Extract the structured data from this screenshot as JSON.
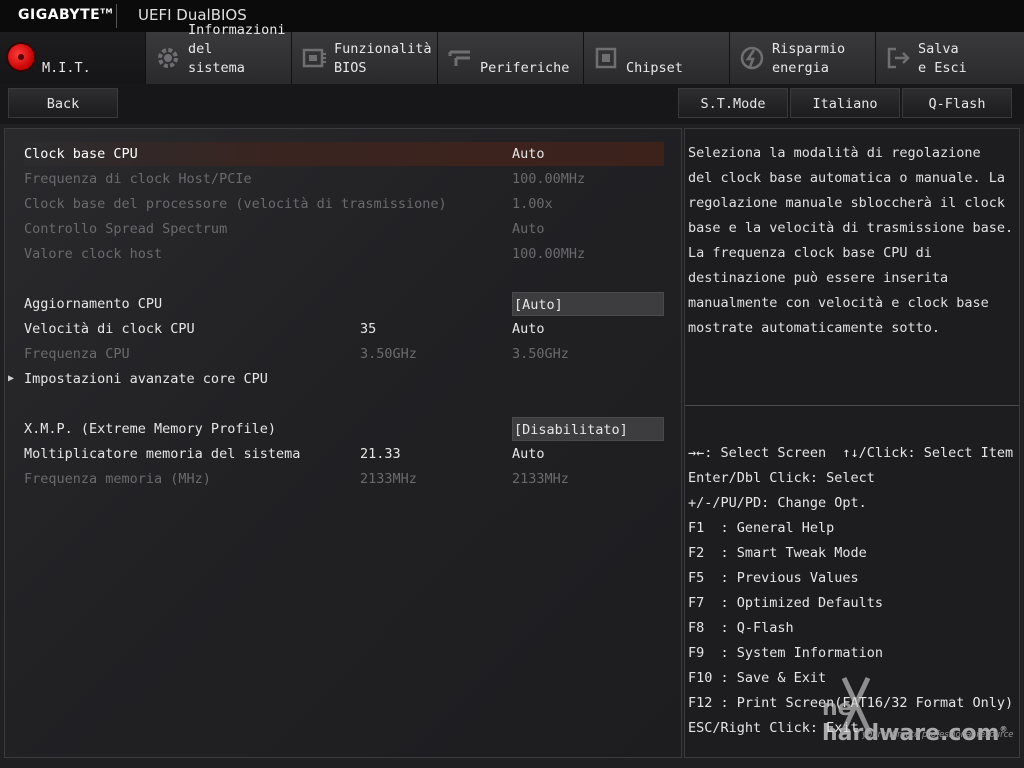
{
  "header": {
    "brand": "GIGABYTE",
    "brand_mark": "TM",
    "product": "UEFI DualBIOS"
  },
  "tabs": [
    {
      "label": "M.I.T.",
      "icon": "mit-red-dot-icon",
      "active": true
    },
    {
      "label": "Informazioni\ndel\nsistema",
      "icon": "gear-icon",
      "active": false
    },
    {
      "label": "Funzionalità\nBIOS",
      "icon": "bios-chip-icon",
      "active": false
    },
    {
      "label": "Periferiche",
      "icon": "peripherals-icon",
      "active": false
    },
    {
      "label": "Chipset",
      "icon": "chipset-icon",
      "active": false
    },
    {
      "label": "Risparmio\nenergia",
      "icon": "power-saving-icon",
      "active": false
    },
    {
      "label": "Salva\ne Esci",
      "icon": "exit-icon",
      "active": false
    }
  ],
  "nav": {
    "back": "Back",
    "st_mode": "S.T.Mode",
    "language": "Italiano",
    "qflash": "Q-Flash"
  },
  "settings": [
    {
      "label": "Clock base CPU",
      "middle": "",
      "value": "Auto",
      "state": "selected"
    },
    {
      "label": "Frequenza di clock Host/PCIe",
      "middle": "",
      "value": "100.00MHz",
      "state": "dim"
    },
    {
      "label": "Clock base del processore (velocità di trasmissione)",
      "middle": "",
      "value": "1.00x",
      "state": "dim"
    },
    {
      "label": "Controllo Spread Spectrum",
      "middle": "",
      "value": "Auto",
      "state": "dim"
    },
    {
      "label": "Valore clock host",
      "middle": "",
      "value": "100.00MHz",
      "state": "dim"
    },
    {
      "label": "Aggiornamento CPU",
      "middle": "",
      "value": "[Auto]",
      "state": "boxed"
    },
    {
      "label": "Velocità di clock CPU",
      "middle": "35",
      "value": "Auto",
      "state": "normal"
    },
    {
      "label": "Frequenza CPU",
      "middle": "3.50GHz",
      "value": "3.50GHz",
      "state": "dim"
    },
    {
      "label": "Impostazioni avanzate core CPU",
      "middle": "",
      "value": "",
      "state": "submenu"
    },
    {
      "label": "X.M.P. (Extreme Memory Profile)",
      "middle": "",
      "value": "[Disabilitato]",
      "state": "boxed"
    },
    {
      "label": "Moltiplicatore memoria del sistema",
      "middle": "21.33",
      "value": "Auto",
      "state": "normal"
    },
    {
      "label": "Frequenza memoria (MHz)",
      "middle": "2133MHz",
      "value": "2133MHz",
      "state": "dim"
    }
  ],
  "help_lines": [
    "Seleziona la modalità di regolazione",
    "del clock base automatica o manuale. La",
    "regolazione manuale sbloccherà il clock",
    "base e la velocità di trasmissione base.",
    "La frequenza clock base CPU di",
    "destinazione può essere inserita",
    "manualmente con velocità e clock base",
    "mostrate automaticamente sotto."
  ],
  "keys": [
    "→←: Select Screen  ↑↓/Click: Select Item",
    "Enter/Dbl Click: Select",
    "+/-/PU/PD: Change Opt.",
    "F1  : General Help",
    "F2  : Smart Tweak Mode",
    "F5  : Previous Values",
    "F7  : Optimized Defaults",
    "F8  : Q-Flash",
    "F9  : System Information",
    "F10 : Save & Exit",
    "F12 : Print Screen(FAT16/32 Format Only)",
    "ESC/Right Click: Exit"
  ],
  "watermark": {
    "prefix": "ne",
    "name": "hardware.com",
    "reg": "®",
    "tagline": "your ultimate professional resource"
  }
}
